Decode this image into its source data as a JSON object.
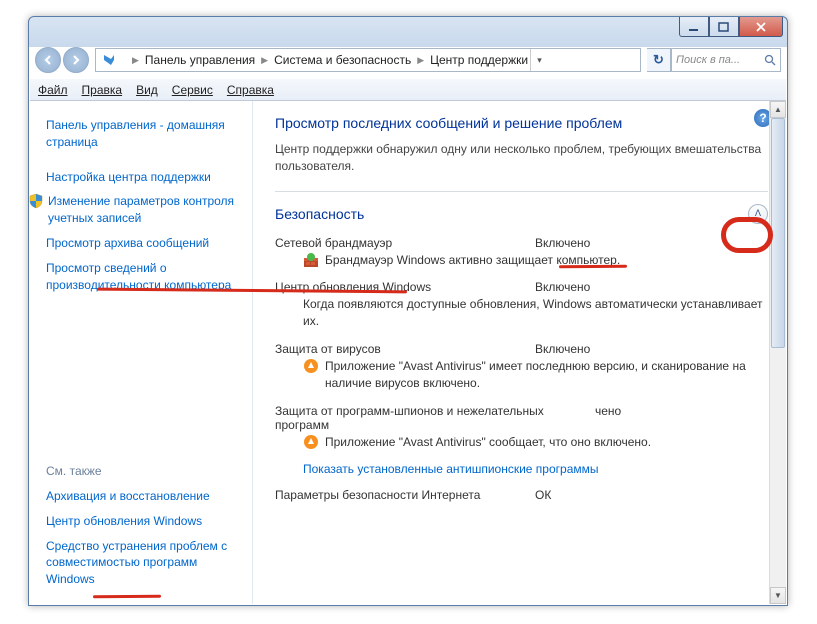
{
  "breadcrumb": {
    "items": [
      "Панель управления",
      "Система и безопасность",
      "Центр поддержки"
    ]
  },
  "search": {
    "placeholder": "Поиск в па..."
  },
  "menu": {
    "items": [
      "Файл",
      "Правка",
      "Вид",
      "Сервис",
      "Справка"
    ]
  },
  "sidebar": {
    "links": [
      "Панель управления - домашняя страница",
      "Настройка центра поддержки",
      "Изменение параметров контроля учетных записей",
      "Просмотр архива сообщений",
      "Просмотр сведений о производительности компьютера"
    ],
    "bottom_heading": "См. также",
    "bottom_links": [
      "Архивация и восстановление",
      "Центр обновления Windows",
      "Средство устранения проблем с совместимостью программ Windows"
    ]
  },
  "content": {
    "title": "Просмотр последних сообщений и решение проблем",
    "intro": "Центр поддержки обнаружил одну или несколько проблем, требующих вмешательства пользователя.",
    "section_title": "Безопасность",
    "rows": [
      {
        "label": "Сетевой брандмауэр",
        "status": "Включено",
        "desc": "Брандмауэр Windows активно защищает компьютер.",
        "icon": "firewall"
      },
      {
        "label": "Центр обновления Windows",
        "status": "Включено",
        "desc": "Когда появляются доступные обновления, Windows автоматически устанавливает их.",
        "icon": null
      },
      {
        "label": "Защита от вирусов",
        "status": "Включено",
        "desc": "Приложение \"Avast Antivirus\" имеет последнюю версию, и сканирование на наличие вирусов включено.",
        "icon": "avast"
      },
      {
        "label": "Защита от программ-шпионов и нежелательных программ",
        "status": "чено",
        "desc": "Приложение \"Avast Antivirus\" сообщает, что оно включено.",
        "icon": "avast"
      }
    ],
    "spyware_link": "Показать установленные антишпионские программы",
    "last_row": {
      "label": "Параметры безопасности Интернета",
      "status": "ОК"
    }
  }
}
